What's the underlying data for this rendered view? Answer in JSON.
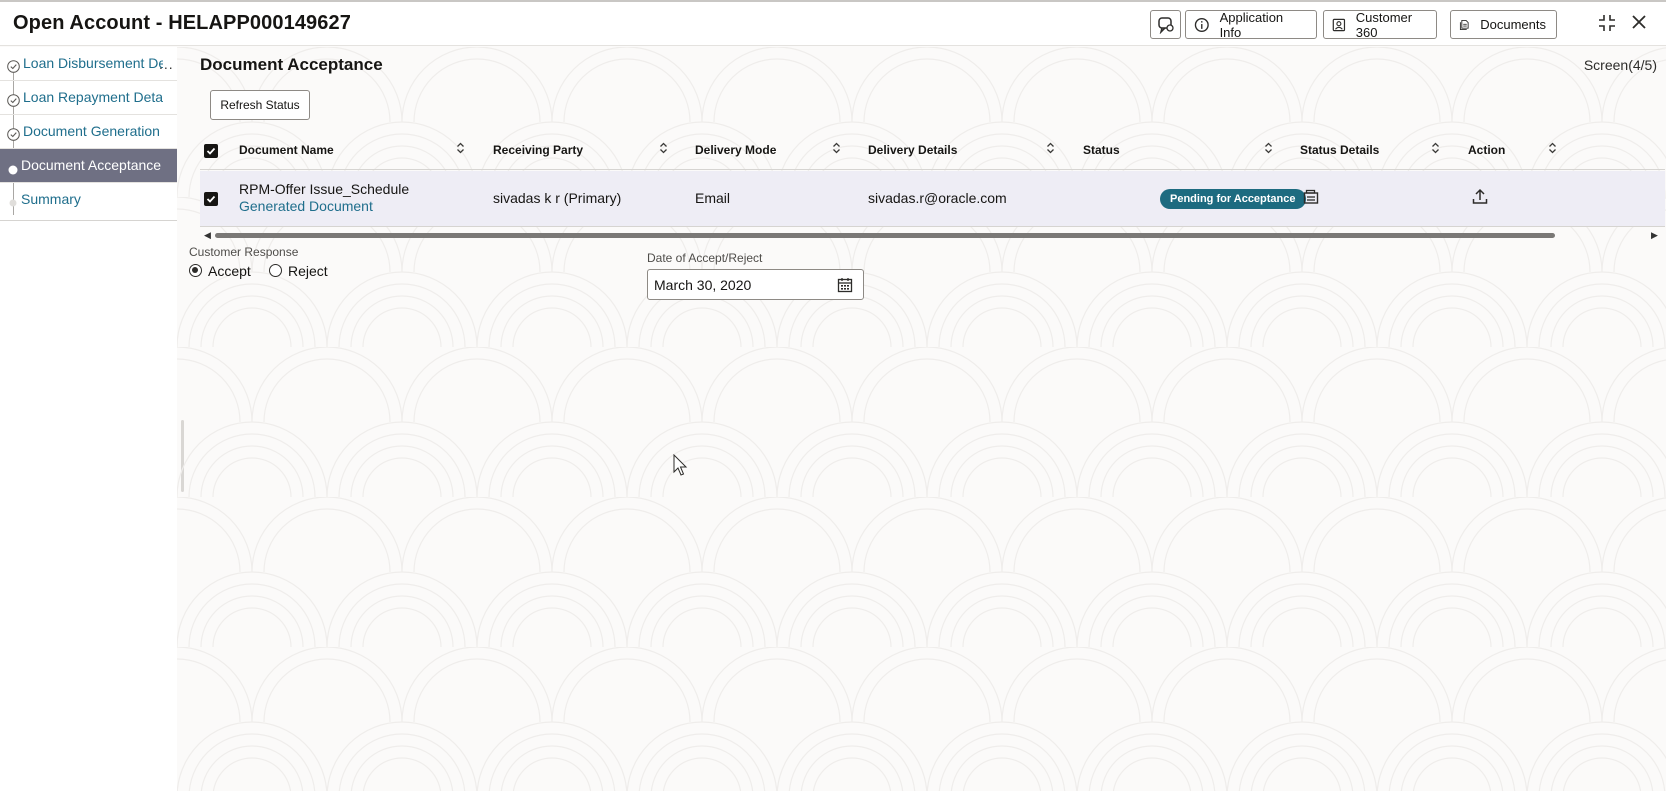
{
  "header": {
    "title": "Open Account - HELAPP000149627",
    "buttons": {
      "application_info": "Application Info",
      "customer_360": "Customer 360",
      "documents": "Documents"
    }
  },
  "sidebar": {
    "items": [
      {
        "label": "Loan Disbursement Det",
        "state": "done"
      },
      {
        "label": "Loan Repayment Details",
        "state": "done"
      },
      {
        "label": "Document Generation",
        "state": "done"
      },
      {
        "label": "Document Acceptance",
        "state": "active"
      },
      {
        "label": "Summary",
        "state": "pending"
      }
    ],
    "more": "..."
  },
  "main": {
    "section_title": "Document Acceptance",
    "screen_indicator": "Screen(4/5)",
    "refresh_button": "Refresh Status",
    "table": {
      "columns": [
        "Document Name",
        "Receiving Party",
        "Delivery Mode",
        "Delivery Details",
        "Status",
        "Status Details",
        "Action"
      ],
      "rows": [
        {
          "document_name": "RPM-Offer Issue_Schedule",
          "document_sub": "Generated Document",
          "receiving_party": "sivadas k r (Primary)",
          "delivery_mode": "Email",
          "delivery_details": "sivadas.r@oracle.com",
          "status": "Pending for Acceptance",
          "checked": true
        }
      ]
    },
    "customer_response": {
      "label": "Customer Response",
      "options": [
        "Accept",
        "Reject"
      ],
      "selected": "Accept"
    },
    "date_accept_reject": {
      "label": "Date of Accept/Reject",
      "value": "March 30, 2020"
    }
  },
  "colors": {
    "accent_link": "#1f6e8c",
    "active_nav": "#6f7083",
    "status_badge": "#1d6b80",
    "row_highlight": "#eeedf5"
  }
}
